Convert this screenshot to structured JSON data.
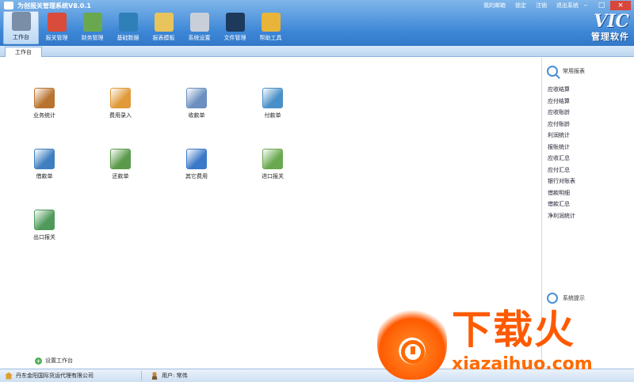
{
  "window": {
    "title": "为创报关管理系统V8.0.1",
    "top_links": [
      "我的邮箱",
      "锁定",
      "注销",
      "退出系统"
    ]
  },
  "toolbar": [
    {
      "label": "工作台",
      "icon": "desk-icon",
      "active": true,
      "color": "#7a8ea8"
    },
    {
      "label": "报关管理",
      "icon": "customs-icon",
      "active": false,
      "color": "#d94b3a"
    },
    {
      "label": "财务管理",
      "icon": "finance-icon",
      "active": false,
      "color": "#6aa84f"
    },
    {
      "label": "基础数据",
      "icon": "database-icon",
      "active": false,
      "color": "#2f7fb8"
    },
    {
      "label": "报表模板",
      "icon": "report-template-icon",
      "active": false,
      "color": "#e8c45c"
    },
    {
      "label": "系统设置",
      "icon": "gear-icon",
      "active": false,
      "color": "#c9cfd8"
    },
    {
      "label": "文件管理",
      "icon": "file-icon",
      "active": false,
      "color": "#1d3a5c"
    },
    {
      "label": "帮助工具",
      "icon": "help-tools-icon",
      "active": false,
      "color": "#e8b53a"
    }
  ],
  "brand": {
    "logo": "VIC",
    "subtitle": "管理软件"
  },
  "tabs": [
    {
      "label": "工作台"
    }
  ],
  "shortcuts": [
    {
      "label": "业务统计",
      "icon": "business-stats-icon",
      "color": "#b8732e"
    },
    {
      "label": "费用录入",
      "icon": "expense-entry-icon",
      "color": "#e09a3a"
    },
    {
      "label": "收款单",
      "icon": "receipt-icon",
      "color": "#6a8fc0"
    },
    {
      "label": "付款单",
      "icon": "payment-icon",
      "color": "#4a90c8"
    },
    {
      "label": "借款单",
      "icon": "loan-icon",
      "color": "#3f7fbf"
    },
    {
      "label": "还款单",
      "icon": "repayment-icon",
      "color": "#5a9a4a"
    },
    {
      "label": "其它费用",
      "icon": "other-expense-icon",
      "color": "#3a78c8"
    },
    {
      "label": "进口报关",
      "icon": "import-customs-icon",
      "color": "#6aa84f"
    },
    {
      "label": "出口报关",
      "icon": "export-customs-icon",
      "color": "#4f9a5a"
    }
  ],
  "setup_workspace": "设置工作台",
  "right_panel": {
    "heading": "常用报表",
    "reports": [
      "应收结算",
      "应付结算",
      "应收账龄",
      "应付账龄",
      "利润统计",
      "报账统计",
      "应收汇总",
      "应付汇总",
      "银行对账表",
      "借款明细",
      "借款汇总",
      "净利润统计"
    ],
    "tip_heading": "系统提示"
  },
  "status": {
    "company": "丹东金阳国际货运代理有限公司",
    "user": "用户: 常伟"
  },
  "watermark": {
    "cn": "下载火",
    "en": "xiazaihuo.com"
  }
}
